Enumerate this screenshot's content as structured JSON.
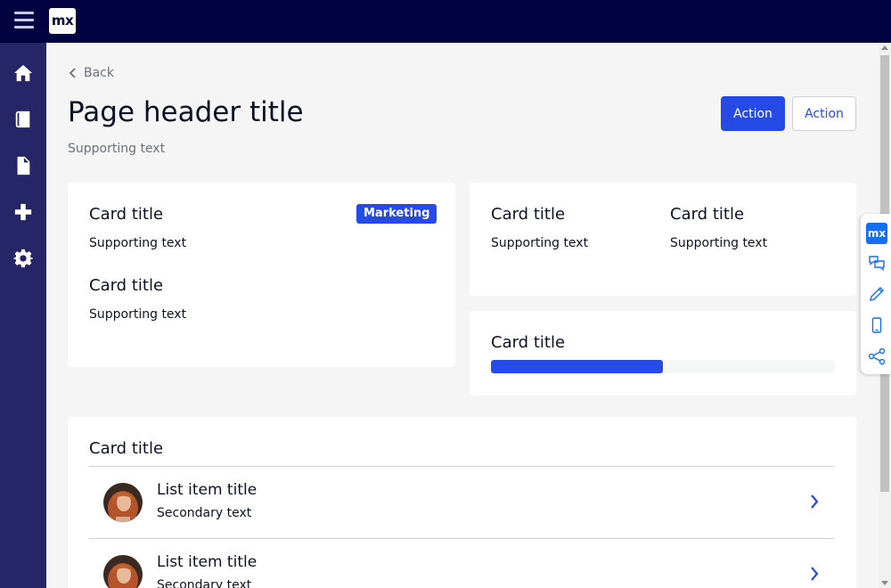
{
  "topbar": {
    "logo_text": "mx"
  },
  "sidebar": {
    "items": [
      {
        "name": "home",
        "icon": "home-icon"
      },
      {
        "name": "book",
        "icon": "book-icon"
      },
      {
        "name": "document",
        "icon": "document-icon"
      },
      {
        "name": "add",
        "icon": "plus-icon"
      },
      {
        "name": "settings",
        "icon": "gear-icon"
      }
    ]
  },
  "header": {
    "back_label": "Back",
    "title": "Page header title",
    "subtitle": "Supporting text",
    "primary_action": "Action",
    "secondary_action": "Action"
  },
  "cards": {
    "card1": {
      "title": "Card title",
      "badge": "Marketing",
      "text": "Supporting text",
      "title2": "Card title",
      "text2": "Supporting text"
    },
    "card2": {
      "col1_title": "Card title",
      "col1_text": "Supporting text",
      "col2_title": "Card title",
      "col2_text": "Supporting text"
    },
    "card3": {
      "title": "Card title",
      "progress": 0.5
    },
    "list_card": {
      "title": "Card title",
      "items": [
        {
          "title": "List item title",
          "subtitle": "Secondary text"
        },
        {
          "title": "List item title",
          "subtitle": "Secondary text"
        }
      ]
    }
  },
  "floating_toolbar": {
    "logo_text": "mx",
    "items": [
      "chat-icon",
      "pencil-icon",
      "mobile-icon",
      "share-icon"
    ]
  },
  "colors": {
    "topbar": "#030341",
    "sidebar": "#252567",
    "brand": "#264ae5",
    "background": "#f5f5f5"
  }
}
